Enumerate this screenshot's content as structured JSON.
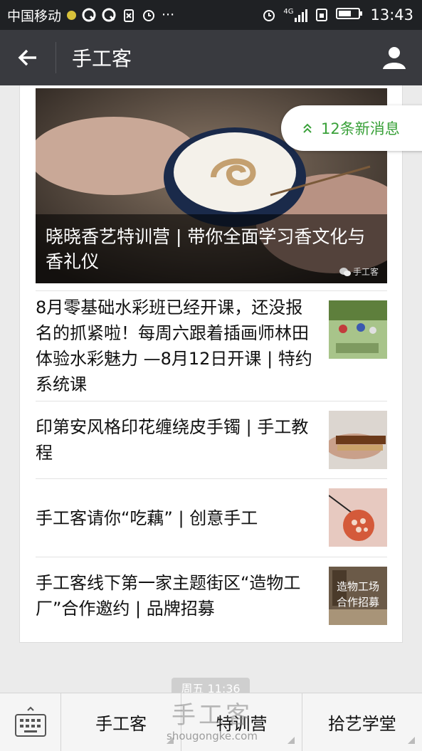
{
  "status_bar": {
    "carrier": "中国移动",
    "network": "4G",
    "time": "13:43"
  },
  "nav": {
    "title": "手工客"
  },
  "hero": {
    "caption": "晓晓香艺特训营 | 带你全面学习香文化与香礼仪",
    "watermark": "手工客"
  },
  "articles": [
    {
      "title": "8月零基础水彩班已经开课，还没报名的抓紧啦！每周六跟着插画师林田体验水彩魅力 —8月12日开课 | 特约系统课",
      "thumb_icon": "watercolor-class-thumb"
    },
    {
      "title": "印第安风格印花缠绕皮手镯 | 手工教程",
      "thumb_icon": "leather-bracelet-thumb"
    },
    {
      "title": "手工客请你“吃藕” | 创意手工",
      "thumb_icon": "lotus-root-thumb"
    },
    {
      "title": "手工客线下第一家主题街区“造物工厂”合作邀约 | 品牌招募",
      "thumb_icon": "factory-thumb",
      "thumb_text": [
        "造物工场",
        "合作招募"
      ]
    }
  ],
  "new_messages": "12条新消息",
  "timestamp": "周五 11:36",
  "bottom_menu": {
    "items": [
      "手工客",
      "特训营",
      "拾艺学堂"
    ]
  },
  "site_watermark": {
    "title": "手工客",
    "url": "shougongke.com"
  },
  "colors": {
    "accent_green": "#3aa13a",
    "nav_bg": "#393a3f",
    "status_bg": "#1f2124"
  }
}
